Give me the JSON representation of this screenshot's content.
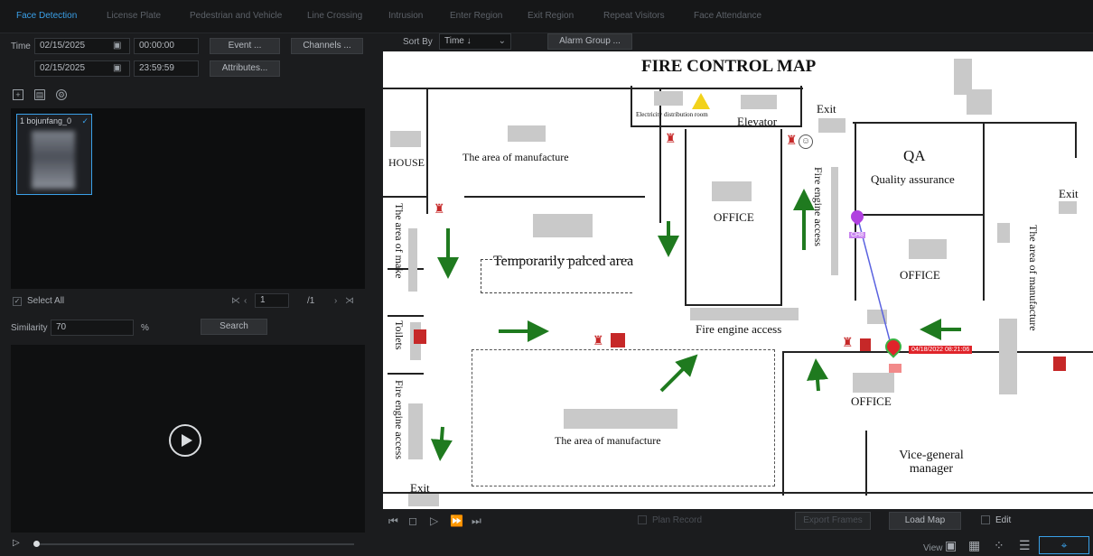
{
  "tabs": [
    "Face Detection",
    "License Plate",
    "Pedestrian and Vehicle",
    "Line Crossing",
    "Intrusion",
    "Enter Region",
    "Exit Region",
    "Repeat Visitors",
    "Face Attendance"
  ],
  "filters": {
    "time_label": "Time",
    "start_date": "02/15/2025",
    "start_time": "00:00:00",
    "end_date": "02/15/2025",
    "end_time": "23:59:59",
    "event_button": "Event ...",
    "channels_button": "Channels ...",
    "attributes_button": "Attributes..."
  },
  "results": {
    "item_label": "1 bojunfang_0",
    "select_all": "Select All",
    "page_current": "1",
    "page_total": "/1",
    "similarity_label": "Similarity",
    "similarity_value": "70",
    "percent": "%",
    "search_button": "Search"
  },
  "sort": {
    "label": "Sort By",
    "value": "Time ↓",
    "alarm_group_button": "Alarm Group ..."
  },
  "map": {
    "title": "FIRE CONTROL MAP",
    "labels": {
      "house": "HOUSE",
      "manufacture_top": "The  area  of  manufacture",
      "electricity": "Electricity distribution room",
      "elevator": "Elevator",
      "exit_top": "Exit",
      "exit_right": "Exit",
      "exit_bottom": "Exit",
      "qa": "QA",
      "qa_full": "Quality assurance",
      "office_center": "OFFICE",
      "office_right": "OFFICE",
      "office_lower": "OFFICE",
      "temp_area": "Temporarily palced area",
      "area_make": "The area  of make",
      "fire_access_vertical": "Fire engine access",
      "fire_access_center": "Fire engine access",
      "fire_access_left": "Fire engine access",
      "toilets": "Toilets",
      "manufacture_bottom": "The  area  of  manufacture",
      "manufacture_right": "The   area   of   manufacture",
      "vice_general": "Vice-general manager",
      "alarm_time": "04/18/2022 08:21:06",
      "marker_purple": "CH8"
    }
  },
  "player_controls": {
    "plan_record": "Plan Record",
    "export_frames": "Export Frames",
    "load_map": "Load Map",
    "edit": "Edit",
    "view": "View"
  },
  "colors": {
    "accent": "#3aa0e8",
    "arrow_green": "#1f7a1f",
    "alarm_red": "#e0242a",
    "marker_purple": "#b040e0"
  }
}
